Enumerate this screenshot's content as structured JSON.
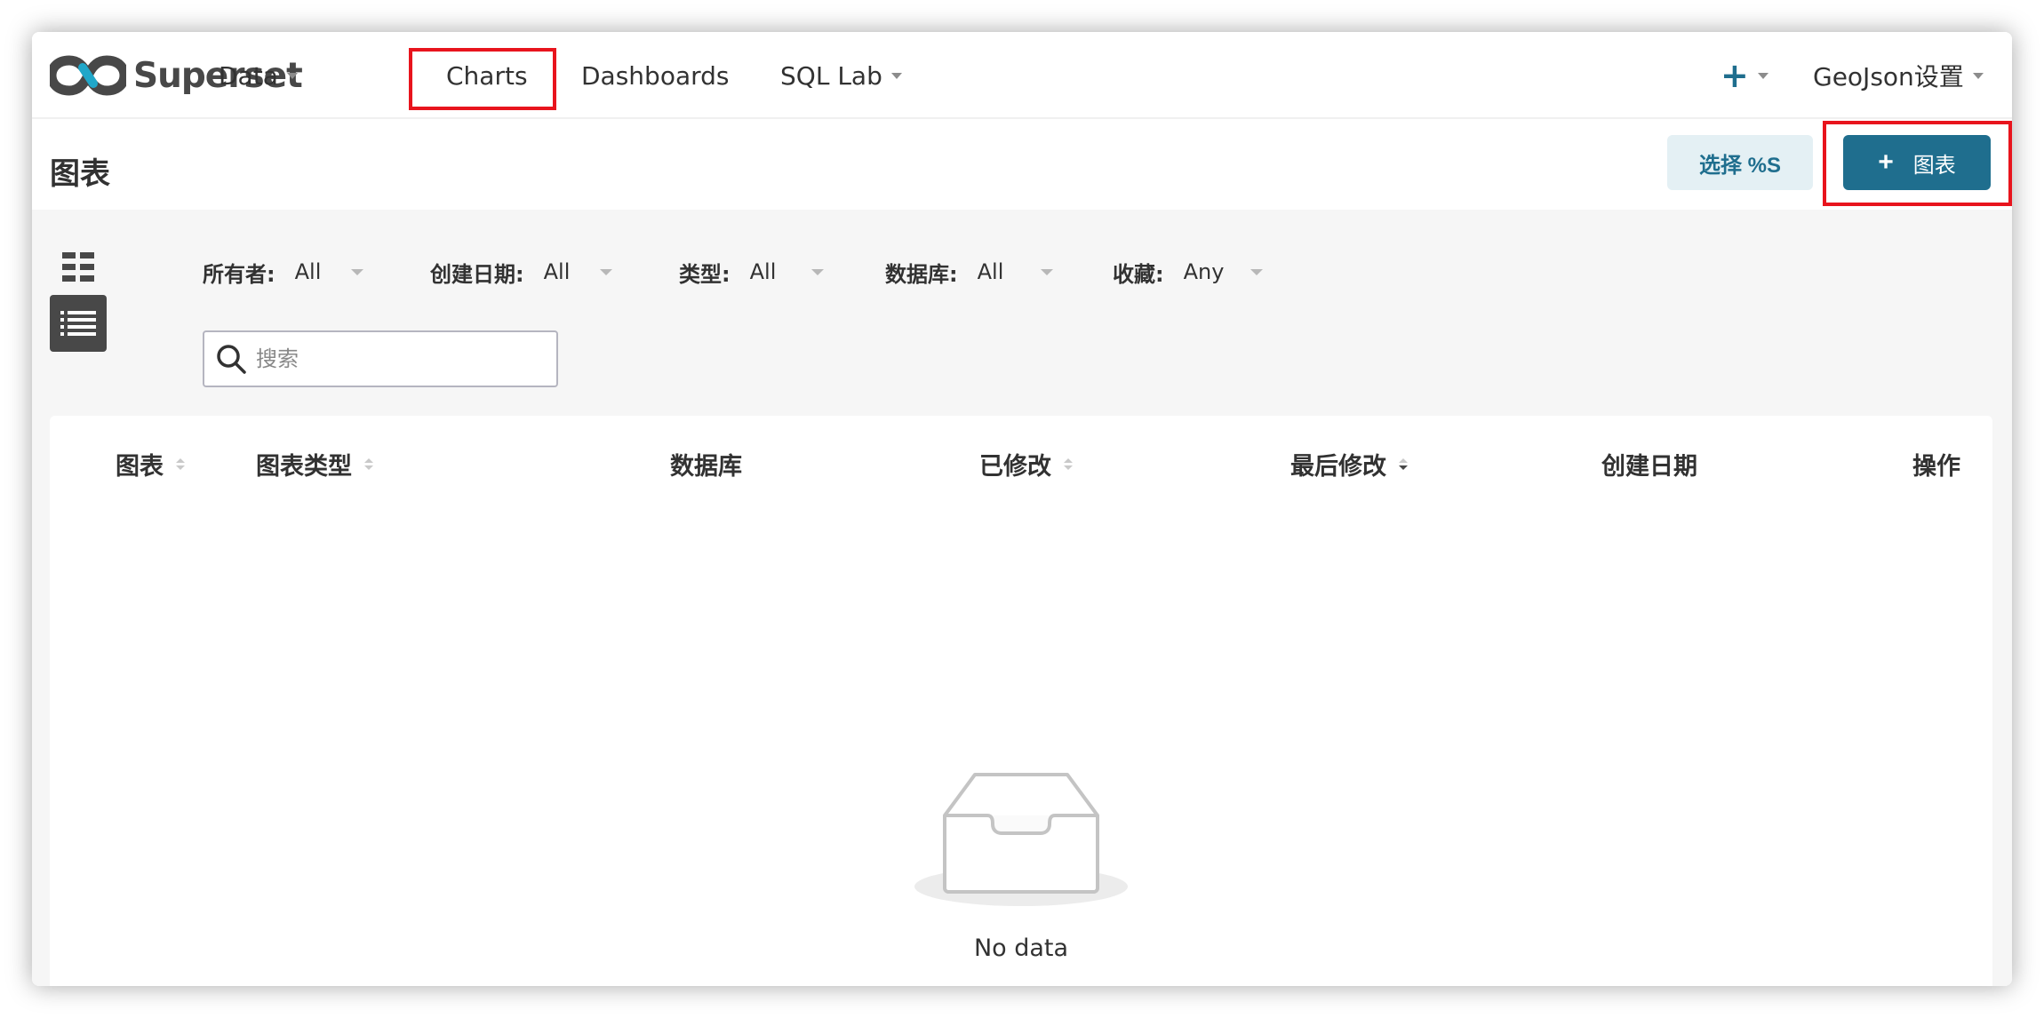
{
  "brand": {
    "name": "Superset"
  },
  "nav": {
    "data": "Data",
    "charts": "Charts",
    "dashboards": "Dashboards",
    "sql_lab": "SQL Lab",
    "settings": "GeoJson设置"
  },
  "header": {
    "title": "图表",
    "select_label": "选择 %S",
    "add_label": "图表"
  },
  "filters": [
    {
      "label": "所有者:",
      "value": "All"
    },
    {
      "label": "创建日期:",
      "value": "All"
    },
    {
      "label": "类型:",
      "value": "All"
    },
    {
      "label": "数据库:",
      "value": "All"
    },
    {
      "label": "收藏:",
      "value": "Any"
    }
  ],
  "search": {
    "placeholder": "搜索"
  },
  "table": {
    "columns": [
      "图表",
      "图表类型",
      "数据库",
      "已修改",
      "最后修改",
      "创建日期",
      "操作"
    ],
    "empty_text": "No data"
  },
  "colors": {
    "primary": "#1f6e8e",
    "primary_light": "#e4f0f4",
    "highlight_border": "#e8141d"
  }
}
